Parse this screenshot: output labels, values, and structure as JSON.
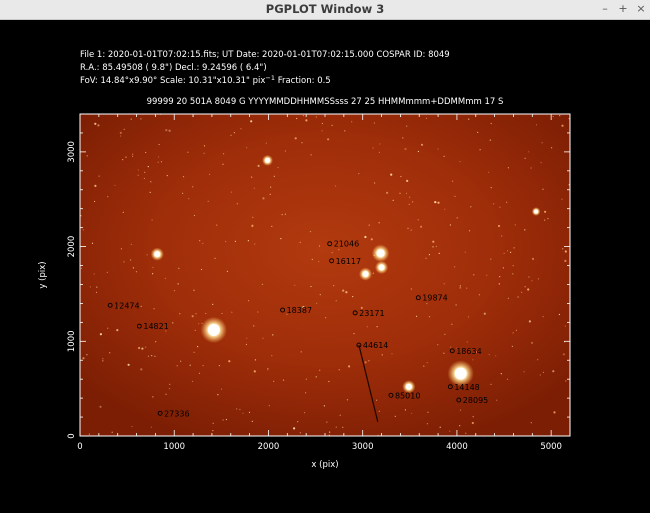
{
  "window": {
    "title": "PGPLOT Window 3",
    "controls": {
      "minimize": "–",
      "maximize": "+",
      "close": "×"
    }
  },
  "header": {
    "line1": "File 1: 2020-01-01T07:02:15.fits; UT Date: 2020-01-01T07:02:15.000   COSPAR ID: 8049",
    "line2": "R.A.:   85.49508 ( 9.8\") Decl.:    9.24596 ( 6.4\")",
    "line3_prefix": "FoV: 14.84°x9.90° Scale: 10.31\"x10.31\" pix",
    "line3_sup": "−1",
    "line3_suffix": " Fraction: 0.5",
    "line4": "99999 20 501A    8049 G YYYYMMDDHHMMSSsss 27 25 HHMMmmm+DDMMmm 17 S"
  },
  "chart_data": {
    "type": "scatter",
    "xlabel": "x (pix)",
    "ylabel": "y (pix)",
    "xlim": [
      0,
      5200
    ],
    "ylim": [
      0,
      3400
    ],
    "xticks": [
      0,
      1000,
      2000,
      3000,
      4000,
      5000
    ],
    "yticks": [
      0,
      1000,
      2000,
      3000
    ],
    "colors": {
      "background": "#9a2a08",
      "frame": "#ffffff",
      "marker": "#000000"
    },
    "labels": [
      {
        "text": "21046",
        "x": 2650,
        "y": 2030
      },
      {
        "text": "16117",
        "x": 2670,
        "y": 1850
      },
      {
        "text": "19874",
        "x": 3590,
        "y": 1460
      },
      {
        "text": "12474",
        "x": 320,
        "y": 1380
      },
      {
        "text": "18387",
        "x": 2150,
        "y": 1330
      },
      {
        "text": "23171",
        "x": 2920,
        "y": 1300
      },
      {
        "text": "14821",
        "x": 630,
        "y": 1160
      },
      {
        "text": "44614",
        "x": 2960,
        "y": 960
      },
      {
        "text": "18634",
        "x": 3950,
        "y": 900
      },
      {
        "text": "14148",
        "x": 3930,
        "y": 520
      },
      {
        "text": "28095",
        "x": 4020,
        "y": 380
      },
      {
        "text": "85010",
        "x": 3300,
        "y": 430
      },
      {
        "text": "27336",
        "x": 850,
        "y": 240
      }
    ],
    "bright_stars": [
      {
        "x": 1420,
        "y": 1120,
        "r": 6
      },
      {
        "x": 4040,
        "y": 660,
        "r": 6
      },
      {
        "x": 3190,
        "y": 1930,
        "r": 4
      },
      {
        "x": 3200,
        "y": 1780,
        "r": 3
      },
      {
        "x": 3030,
        "y": 1710,
        "r": 3
      },
      {
        "x": 820,
        "y": 1920,
        "r": 3
      },
      {
        "x": 3490,
        "y": 520,
        "r": 3
      },
      {
        "x": 1990,
        "y": 2910,
        "r": 2.5
      },
      {
        "x": 4840,
        "y": 2370,
        "r": 2
      }
    ],
    "trail": {
      "x1": 2960,
      "y1": 960,
      "x2": 3160,
      "y2": 150
    }
  }
}
